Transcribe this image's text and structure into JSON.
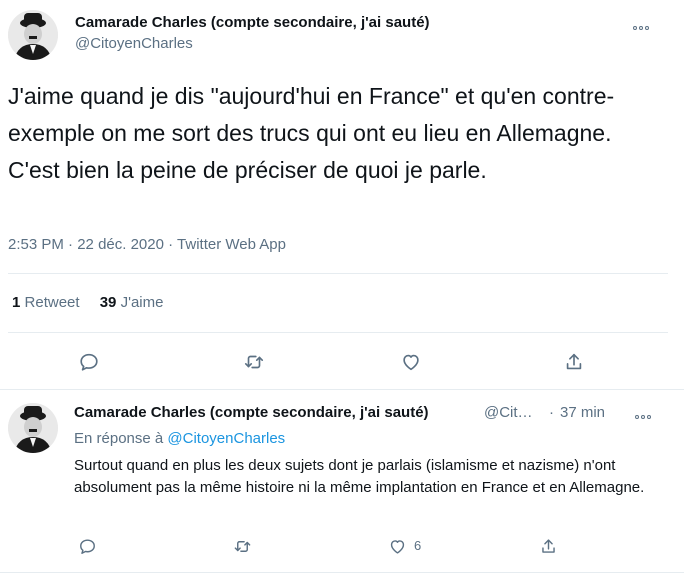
{
  "tweet": {
    "author_name": "Camarade Charles (compte secondaire, j'ai sauté)",
    "author_handle": "@CitoyenCharles",
    "text": "J'aime quand je dis \"aujourd'hui en France\" et qu'en contre-exemple on me sort des trucs qui ont eu lieu en Allemagne. C'est bien la peine de préciser de quoi je parle.",
    "time": "2:53 PM",
    "date": "22 déc. 2020",
    "source": "Twitter Web App",
    "separator": "·",
    "retweet_count": "1",
    "retweet_label": "Retweet",
    "like_count": "39",
    "like_label": "J'aime"
  },
  "reply": {
    "author_name": "Camarade Charles (compte secondaire, j'ai sauté)",
    "author_handle": "@Cit…",
    "time_ago": "37 min",
    "separator": "·",
    "reply_to_prefix": "En réponse à",
    "reply_to_handle": "@CitoyenCharles",
    "text": "Surtout quand en plus les deux sujets dont je parlais (islamisme et nazisme) n'ont absolument pas la même histoire ni la même implantation en France et en Allemagne.",
    "like_count": "6"
  },
  "icons": [
    "reply-icon",
    "retweet-icon",
    "like-icon",
    "share-icon",
    "more-icon"
  ],
  "colors": {
    "text": "#0f1419",
    "secondary": "#5b7083",
    "link": "#1b95e0",
    "divider": "#e6ecf0"
  }
}
